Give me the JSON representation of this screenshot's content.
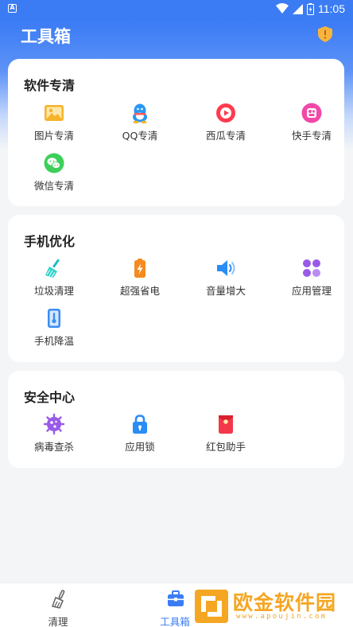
{
  "status_bar": {
    "time": "11:05"
  },
  "header": {
    "title": "工具箱"
  },
  "sections": [
    {
      "title": "软件专清",
      "items": [
        {
          "label": "图片专清",
          "icon": "image-icon"
        },
        {
          "label": "QQ专清",
          "icon": "qq-icon"
        },
        {
          "label": "西瓜专清",
          "icon": "xigua-icon"
        },
        {
          "label": "快手专清",
          "icon": "kuaishou-icon"
        },
        {
          "label": "微信专清",
          "icon": "wechat-icon"
        }
      ]
    },
    {
      "title": "手机优化",
      "items": [
        {
          "label": "垃圾清理",
          "icon": "broom-icon"
        },
        {
          "label": "超强省电",
          "icon": "battery-icon"
        },
        {
          "label": "音量增大",
          "icon": "speaker-icon"
        },
        {
          "label": "应用管理",
          "icon": "apps-icon"
        },
        {
          "label": "手机降温",
          "icon": "thermometer-icon"
        }
      ]
    },
    {
      "title": "安全中心",
      "items": [
        {
          "label": "病毒查杀",
          "icon": "virus-icon"
        },
        {
          "label": "应用锁",
          "icon": "lock-icon"
        },
        {
          "label": "红包助手",
          "icon": "red-envelope-icon"
        }
      ]
    }
  ],
  "bottom_nav": [
    {
      "label": "清理",
      "icon": "brush-icon",
      "active": false
    },
    {
      "label": "工具箱",
      "icon": "toolbox-icon",
      "active": true
    }
  ],
  "watermark": {
    "text": "欧金软件园",
    "url": "www.apoujin.com"
  },
  "colors": {
    "primary": "#3b7cf5",
    "watermark": "#f5a623"
  }
}
